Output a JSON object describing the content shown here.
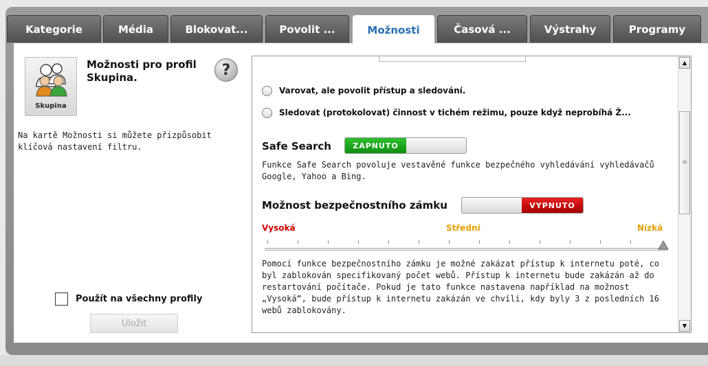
{
  "tabs": [
    {
      "label": "Kategorie",
      "active": false
    },
    {
      "label": "Média",
      "active": false
    },
    {
      "label": "Blokovat...",
      "active": false
    },
    {
      "label": "Povolit ...",
      "active": false
    },
    {
      "label": "Možnosti",
      "active": true
    },
    {
      "label": "Časová ...",
      "active": false
    },
    {
      "label": "Výstrahy",
      "active": false
    },
    {
      "label": "Programy",
      "active": false
    }
  ],
  "profile": {
    "icon_label": "Skupina",
    "title": "Možnosti pro profil Skupina.",
    "description": "Na kartě Možnosti si můžete přizpůsobit klíčová nastavení filtru.",
    "help_icon": "?"
  },
  "apply_all": {
    "label": "Použít na všechny profily",
    "checked": false
  },
  "save_button": {
    "label": "Uložit",
    "enabled": false
  },
  "options": {
    "radio_1": "Varovat, ale povolit přístup a sledování.",
    "radio_2": "Sledovat (protokolovat) činnost v tichém režimu, pouze když neprobíhá Ž..."
  },
  "safe_search": {
    "title": "Safe Search",
    "toggle_label": "ZAPNUTO",
    "state": "on",
    "description": "Funkce Safe Search povoluje vestavěné funkce bezpečného vyhledávání vyhledávačů Google, Yahoo a Bing."
  },
  "lock": {
    "title": "Možnost bezpečnostního zámku",
    "toggle_label": "VYPNUTO",
    "state": "off",
    "levels": {
      "high": "Vysoká",
      "medium": "Střední",
      "low": "Nízká"
    },
    "slider_value": "Nízká",
    "description": "Pomocí funkce bezpečnostního zámku je možné zakázat přístup k internetu poté, co byl zablokován specifikovaný počet webů.  Přístup k internetu bude zakázán až do restartování počítače.  Pokud je tato funkce nastavena například na možnost „Vysoká“, bude přístup k internetu zakázán ve chvíli, kdy byly 3 z posledních 16 webů zablokovány."
  },
  "colors": {
    "active_tab_text": "#2a6fb0",
    "on_green": "#1aa21a",
    "off_red": "#c40000",
    "level_high": "#cc0000",
    "level_medium": "#e6a000",
    "level_low": "#e6a000"
  }
}
